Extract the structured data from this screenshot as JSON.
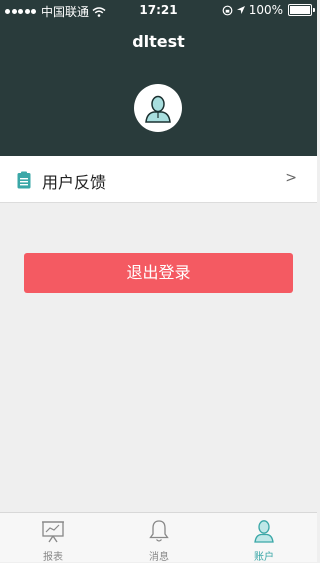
{
  "status_bar": {
    "carrier": "中国联通",
    "time": "17:21",
    "battery": "100%"
  },
  "profile": {
    "username": "dltest"
  },
  "menu": {
    "feedback_label": "用户反馈",
    "chevron": ">"
  },
  "logout_label": "退出登录",
  "tabs": [
    {
      "label": "报表",
      "icon": "chart-board-icon",
      "active": false
    },
    {
      "label": "消息",
      "icon": "bell-icon",
      "active": false
    },
    {
      "label": "账户",
      "icon": "user-icon",
      "active": true
    }
  ],
  "colors": {
    "header_bg": "#293b3b",
    "logout_bg": "#f45a62",
    "accent": "#3aa7a7"
  }
}
